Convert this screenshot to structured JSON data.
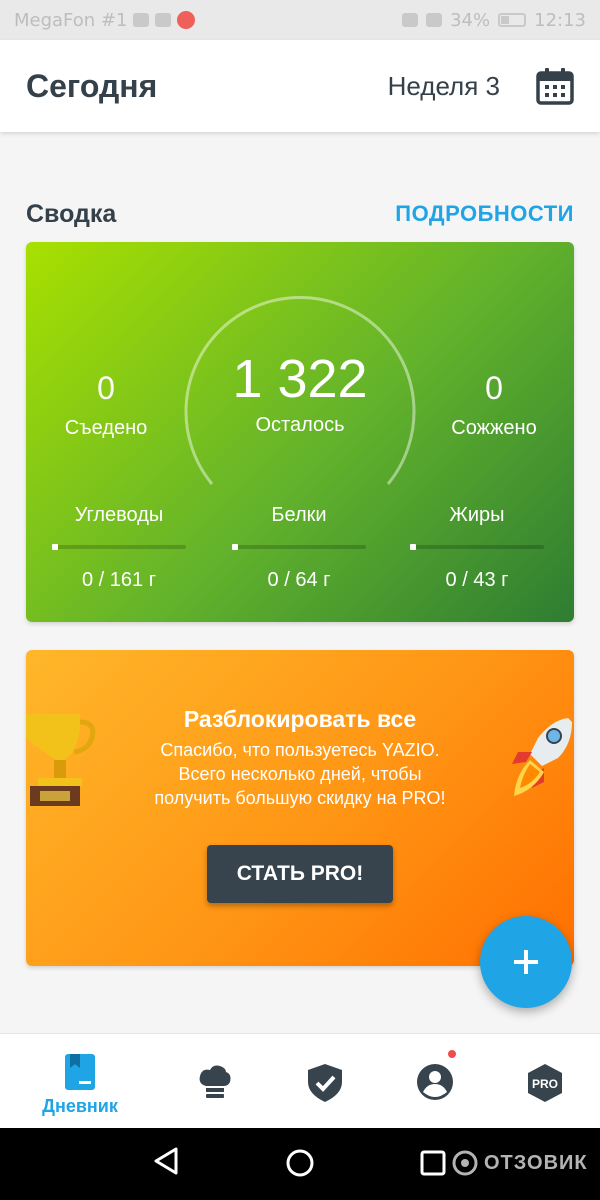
{
  "status_bar": {
    "carrier": "MegaFon #1",
    "battery": "34%",
    "time": "12:13"
  },
  "app_bar": {
    "title": "Сегодня",
    "week": "Неделя 3"
  },
  "summary": {
    "title": "Сводка",
    "details_link": "ПОДРОБНОСТИ",
    "eaten": {
      "value": "0",
      "label": "Съедено"
    },
    "remaining": {
      "value": "1 322",
      "label": "Осталось"
    },
    "burned": {
      "value": "0",
      "label": "Сожжено"
    },
    "macros": [
      {
        "name": "Углеводы",
        "value": "0 / 161 г",
        "progress": 0
      },
      {
        "name": "Белки",
        "value": "0 / 64 г",
        "progress": 0
      },
      {
        "name": "Жиры",
        "value": "0 / 43 г",
        "progress": 0
      }
    ],
    "gradient_colors": [
      "#a8e000",
      "#2e7d32"
    ]
  },
  "promo": {
    "title": "Разблокировать все",
    "line1": "Спасибо, что пользуетесь YAZIO.",
    "line2": "Всего несколько дней, чтобы",
    "line3": "получить большую скидку на PRO!",
    "button": "СТАТЬ PRO!",
    "gradient_colors": [
      "#ffb72a",
      "#ff6f00"
    ]
  },
  "fab": {
    "icon": "plus-icon",
    "color": "#1fa4e6"
  },
  "bottom_nav": {
    "items": [
      {
        "icon": "diary-icon",
        "label": "Дневник",
        "active": true
      },
      {
        "icon": "chef-hat-icon",
        "label": "",
        "active": false
      },
      {
        "icon": "shield-check-icon",
        "label": "",
        "active": false
      },
      {
        "icon": "profile-icon",
        "label": "",
        "active": false,
        "badge": true
      },
      {
        "icon": "pro-hexagon-icon",
        "label": "",
        "active": false
      }
    ],
    "pro_badge_text": "PRO",
    "accent": "#1fa4e6"
  },
  "watermark": {
    "text": "ОТЗОВИК"
  }
}
